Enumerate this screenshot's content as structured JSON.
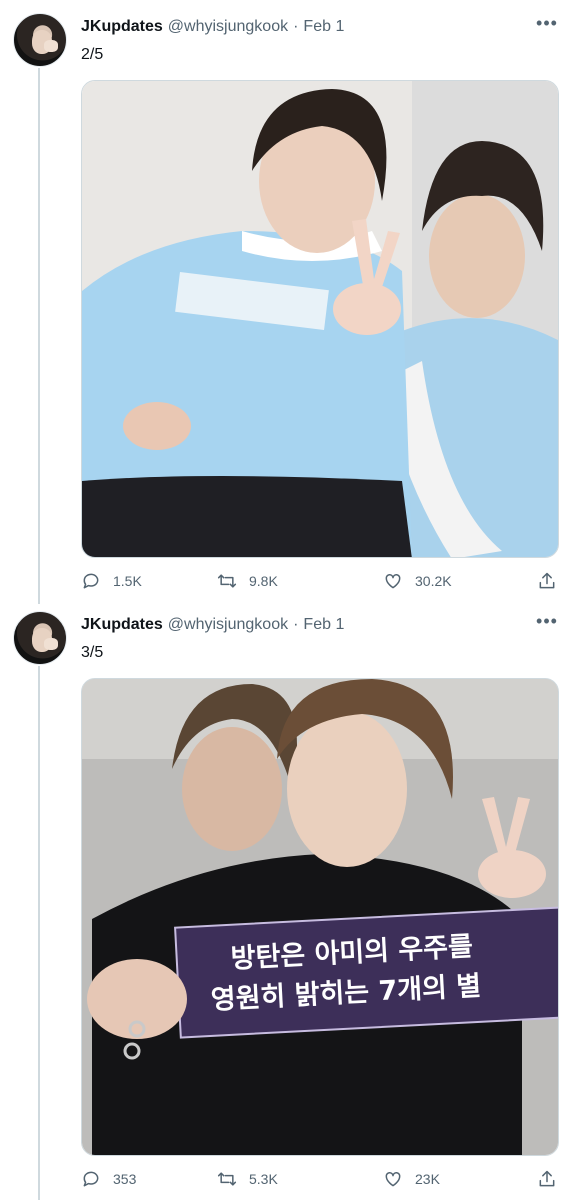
{
  "tweets": [
    {
      "display_name": "JKupdates",
      "handle": "@whyisjungkook",
      "separator": "·",
      "date": "Feb 1",
      "text": "2/5",
      "more_label": "•••",
      "replies": "1.5K",
      "retweets": "9.8K",
      "likes": "30.2K",
      "icons": [
        "reply-icon",
        "retweet-icon",
        "like-icon",
        "share-icon"
      ]
    },
    {
      "display_name": "JKupdates",
      "handle": "@whyisjungkook",
      "separator": "·",
      "date": "Feb 1",
      "text": "3/5",
      "more_label": "•••",
      "replies": "353",
      "retweets": "5.3K",
      "likes": "23K",
      "icons": [
        "reply-icon",
        "retweet-icon",
        "like-icon",
        "share-icon"
      ],
      "banner_line1": "방탄은 아미의 우주를",
      "banner_line2": "영원히 밝히는 7개의 별"
    }
  ],
  "colors": {
    "text": "#0f1419",
    "secondary": "#536471",
    "border": "#cfd9de",
    "thread_line": "#cfd9de"
  }
}
